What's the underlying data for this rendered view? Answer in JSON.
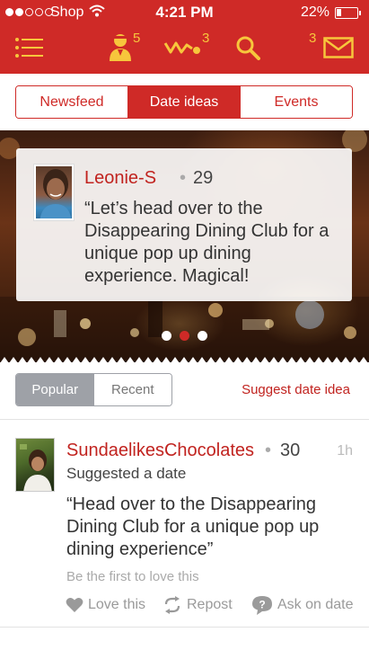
{
  "status_bar": {
    "carrier": "Shop",
    "time": "4:21 PM",
    "battery": "22%",
    "battery_level": 0.22,
    "signal_bars_filled": 2,
    "signal_bars_total": 5
  },
  "nav": {
    "menu_icon": "hamburger-menu-icon",
    "profile_badge": "5",
    "activity_badge": "3",
    "messages_badge": "3",
    "accent_color": "#cf2a27",
    "badge_color": "#f7c63c"
  },
  "tabs": [
    {
      "label": "Newsfeed",
      "active": false
    },
    {
      "label": "Date ideas",
      "active": true
    },
    {
      "label": "Events",
      "active": false
    }
  ],
  "featured": {
    "name": "Leonie-S",
    "separator": "•",
    "age": "29",
    "quote": "“Let’s head over to the Disappearing Dining Club for a unique pop up dining experience. Magical!",
    "pages": 3,
    "active_page": 2
  },
  "filter": {
    "options": [
      {
        "label": "Popular",
        "active": true
      },
      {
        "label": "Recent",
        "active": false
      }
    ],
    "suggest_label": "Suggest date idea"
  },
  "feed": [
    {
      "name": "SundaelikesChocolates",
      "separator": "•",
      "age": "30",
      "time": "1h",
      "action": "Suggested a date",
      "quote": "“Head over to the Disappearing Dining Club for a unique pop up dining experience”",
      "love_hint": "Be the first to love this",
      "actions": {
        "love": "Love this",
        "repost": "Repost",
        "ask": "Ask on date"
      }
    }
  ]
}
